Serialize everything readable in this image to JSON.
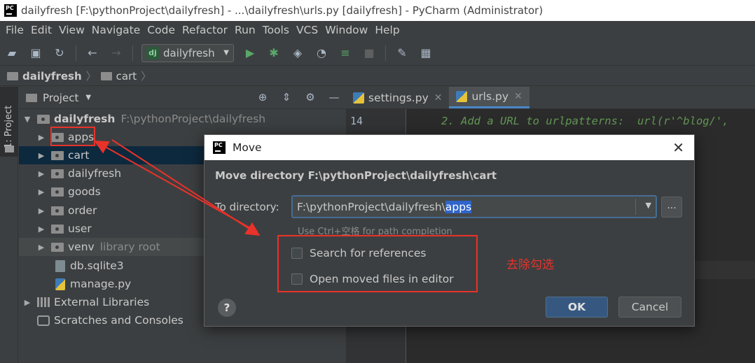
{
  "window": {
    "title": "dailyfresh [F:\\pythonProject\\dailyfresh] - ...\\dailyfresh\\urls.py [dailyfresh] - PyCharm (Administrator)",
    "logo_text": "PC"
  },
  "menu": [
    "File",
    "Edit",
    "View",
    "Navigate",
    "Code",
    "Refactor",
    "Run",
    "Tools",
    "VCS",
    "Window",
    "Help"
  ],
  "toolbar": {
    "run_config": "dailyfresh",
    "run_config_icon": "dj"
  },
  "breadcrumb": [
    "dailyfresh",
    "cart"
  ],
  "stripe": {
    "label": "1: Project"
  },
  "project": {
    "header": "Project",
    "root": {
      "name": "dailyfresh",
      "path": "F:\\pythonProject\\dailyfresh"
    },
    "items": [
      {
        "name": "apps"
      },
      {
        "name": "cart"
      },
      {
        "name": "dailyfresh"
      },
      {
        "name": "goods"
      },
      {
        "name": "order"
      },
      {
        "name": "user"
      },
      {
        "name": "venv",
        "note": "library root"
      },
      {
        "name": "db.sqlite3"
      },
      {
        "name": "manage.py"
      }
    ],
    "external": "External Libraries",
    "scratches": "Scratches and Consoles"
  },
  "editor": {
    "tabs": [
      "settings.py",
      "urls.py"
    ],
    "line_number": "14",
    "code_line": "2. Add a URL to urlpatterns:  url(r'^blog/',"
  },
  "dialog": {
    "title": "Move",
    "heading": "Move directory F:\\pythonProject\\dailyfresh\\cart",
    "to_label": "To directory:",
    "path_prefix": "F:\\pythonProject\\dailyfresh\\",
    "path_selected": "apps",
    "browse": "...",
    "hint": "Use Ctrl+空格 for path completion",
    "checkbox1": "Search for references",
    "checkbox2": "Open moved files in editor",
    "checkbox1_checked": false,
    "checkbox2_checked": false,
    "help": "?",
    "ok": "OK",
    "cancel": "Cancel"
  },
  "annotation": {
    "text": "去除勾选",
    "color": "#e8322a"
  }
}
